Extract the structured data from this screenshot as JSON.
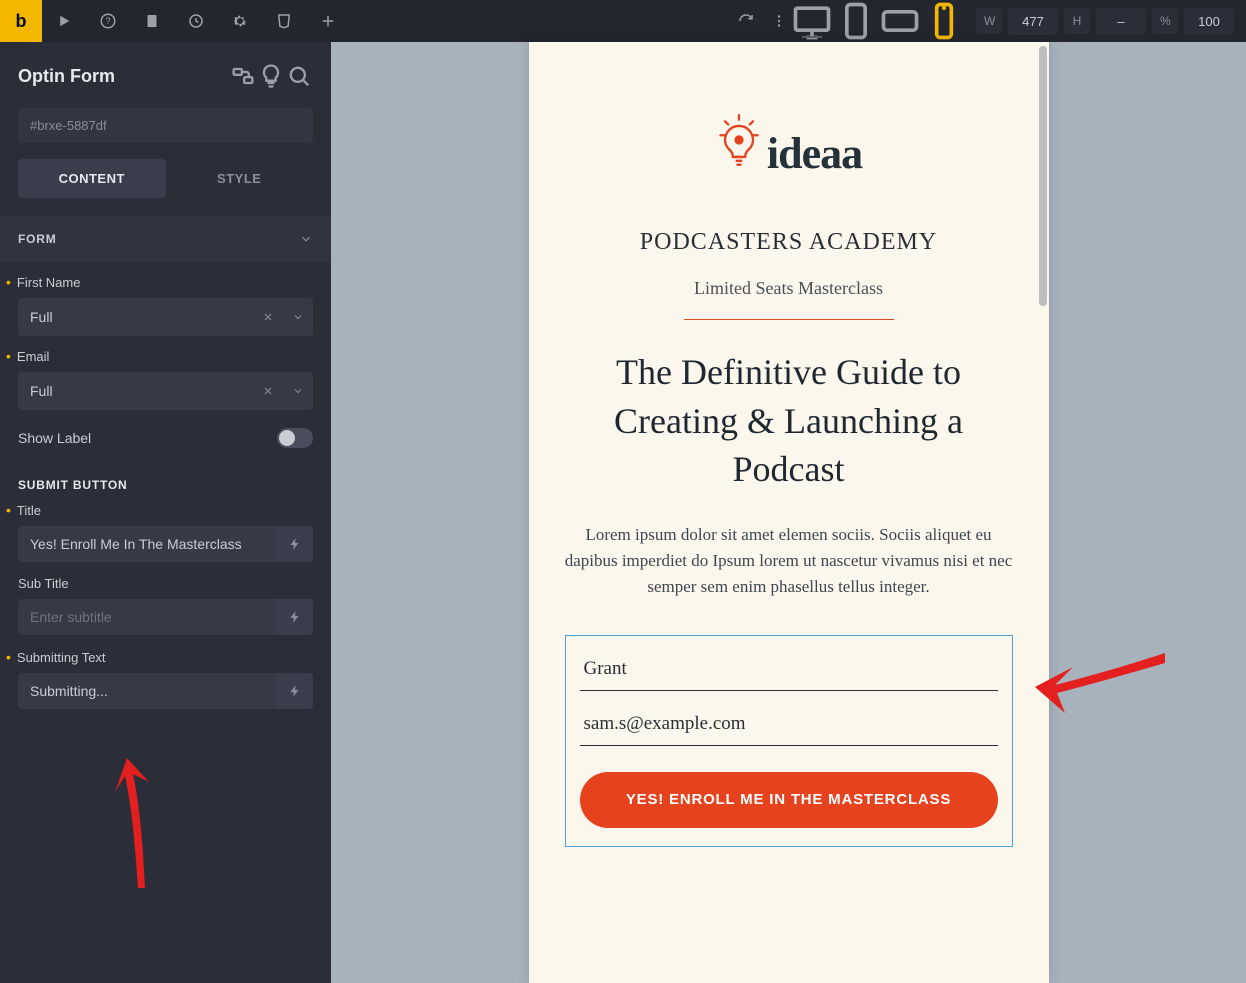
{
  "topbar": {
    "logo_letter": "b",
    "dim_w_label": "W",
    "dim_w_value": "477",
    "dim_h_label": "H",
    "dim_h_value": "–",
    "dim_pct_label": "%",
    "dim_pct_value": "100"
  },
  "panel": {
    "title": "Optin Form",
    "css_selector": "#brxe-5887df",
    "tabs": {
      "content": "CONTENT",
      "style": "STYLE"
    },
    "form_section_title": "FORM",
    "fields": {
      "first_name_label": "First Name",
      "first_name_width": "Full",
      "email_label": "Email",
      "email_width": "Full",
      "show_label": "Show Label"
    },
    "submit_section_title": "SUBMIT BUTTON",
    "submit": {
      "title_label": "Title",
      "title_value": "Yes! Enroll Me In The Masterclass",
      "subtitle_label": "Sub Title",
      "subtitle_placeholder": "Enter subtitle",
      "subtitle_value": "",
      "submitting_label": "Submitting Text",
      "submitting_value": "Submitting..."
    }
  },
  "preview": {
    "logo_text": "ideaa",
    "eyebrow": "PODCASTERS ACADEMY",
    "subeyebrow": "Limited Seats Masterclass",
    "headline": "The Definitive Guide to Creating & Launching a Podcast",
    "body": "Lorem ipsum dolor sit amet elemen sociis. Sociis aliquet eu dapibus imperdiet do Ipsum lorem ut nascetur vivamus nisi et nec semper sem enim phasellus tellus integer.",
    "first_name_value": "Grant",
    "email_value": "sam.s@example.com",
    "submit_label": "YES! ENROLL ME IN THE MASTERCLASS"
  }
}
